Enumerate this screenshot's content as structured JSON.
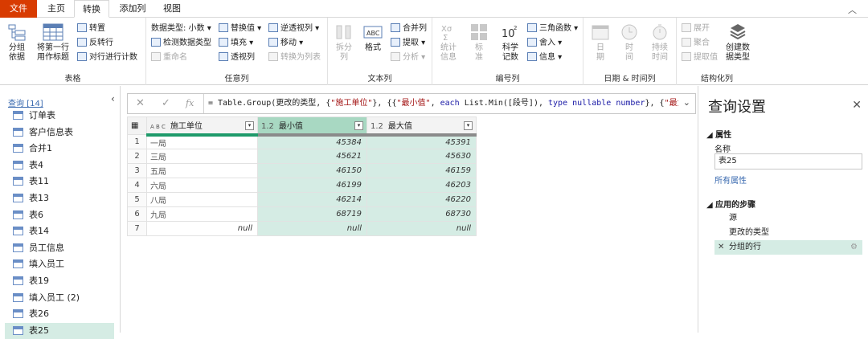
{
  "menu": {
    "tabs": [
      "文件",
      "主页",
      "转换",
      "添加列",
      "视图"
    ],
    "active": "转换"
  },
  "ribbon": {
    "table_group": {
      "label": "表格",
      "group_by": "分组依据",
      "first_row": "将第一行用作标题",
      "transpose": "转置",
      "reverse_rows": "反转行",
      "count_rows": "对行进行计数"
    },
    "any_column": {
      "label": "任意列",
      "data_type": "数据类型: 小数",
      "detect_type": "检测数据类型",
      "rename": "重命名",
      "replace": "替换值",
      "fill": "填充",
      "pivot": "透视列",
      "unpivot": "逆透视列",
      "move": "移动",
      "to_list": "转换为列表"
    },
    "text_column": {
      "label": "文本列",
      "split": "拆分列",
      "format": "格式",
      "merge": "合并列",
      "extract": "提取",
      "parse": "分析"
    },
    "number_column": {
      "label": "编号列",
      "stats": "统计信息",
      "standard": "标准",
      "scientific": "科学记数",
      "trig": "三角函数",
      "round": "舍入",
      "info": "信息"
    },
    "datetime_column": {
      "label": "日期 & 时间列",
      "date": "日期",
      "time": "时间",
      "duration": "持续时间"
    },
    "structured_column": {
      "label": "结构化列",
      "expand": "展开",
      "aggregate": "聚合",
      "extract_values": "提取值",
      "create_type": "创建数据类型"
    }
  },
  "queries": {
    "header": "查询 [14]",
    "items": [
      "订单表",
      "客户信息表",
      "合并1",
      "表4",
      "表11",
      "表13",
      "表6",
      "表14",
      "员工信息",
      "填入员工",
      "表19",
      "填入员工 (2)",
      "表26",
      "表25"
    ],
    "selected": "表25"
  },
  "formula": "= Table.Group(更改的类型, {\"施工单位\"}, {{\"最小值\", each List.Min([段号]), type nullable number}, {\"最大",
  "grid": {
    "columns": [
      {
        "type": "A B C",
        "name": "施工单位"
      },
      {
        "type": "1.2",
        "name": "最小值"
      },
      {
        "type": "1.2",
        "name": "最大值"
      }
    ],
    "rows": [
      [
        "1",
        "一局",
        "45384",
        "45391"
      ],
      [
        "2",
        "三局",
        "45621",
        "45630"
      ],
      [
        "3",
        "五局",
        "46150",
        "46159"
      ],
      [
        "4",
        "六局",
        "46199",
        "46203"
      ],
      [
        "5",
        "八局",
        "46214",
        "46220"
      ],
      [
        "6",
        "九局",
        "68719",
        "68730"
      ],
      [
        "7",
        "null",
        "null",
        "null"
      ]
    ]
  },
  "settings": {
    "title": "查询设置",
    "properties_heading": "属性",
    "name_label": "名称",
    "name_value": "表25",
    "all_properties": "所有属性",
    "steps_heading": "应用的步骤",
    "steps": [
      "源",
      "更改的类型",
      "分组的行"
    ]
  }
}
